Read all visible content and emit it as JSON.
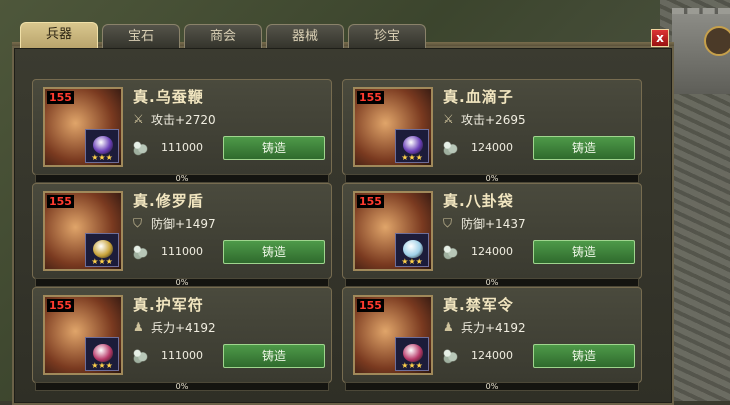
{
  "tabs": [
    {
      "label": "兵器",
      "active": true
    },
    {
      "label": "宝石"
    },
    {
      "label": "商会"
    },
    {
      "label": "器械"
    },
    {
      "label": "珍宝"
    }
  ],
  "close_label": "x",
  "forge_label": "铸造",
  "items": [
    {
      "level": "155",
      "name": "真.乌蚕鞭",
      "stat_icon": "sword-icon",
      "stat": "攻击+2720",
      "cost": "111000",
      "progress": "0%",
      "progress_value": 0,
      "gem_color": "#6a3fb8",
      "stars": "★★★"
    },
    {
      "level": "155",
      "name": "真.血滴子",
      "stat_icon": "sword-icon",
      "stat": "攻击+2695",
      "cost": "124000",
      "progress": "0%",
      "progress_value": 0,
      "gem_color": "#6a3fb8",
      "stars": "★★★"
    },
    {
      "level": "155",
      "name": "真.修罗盾",
      "stat_icon": "shield-icon",
      "stat": "防御+1497",
      "cost": "111000",
      "progress": "0%",
      "progress_value": 0,
      "gem_color": "#c8a33a",
      "stars": "★★★"
    },
    {
      "level": "155",
      "name": "真.八卦袋",
      "stat_icon": "shield-icon",
      "stat": "防御+1437",
      "cost": "124000",
      "progress": "0%",
      "progress_value": 0,
      "gem_color": "#9fd0e8",
      "stars": "★★★"
    },
    {
      "level": "155",
      "name": "真.护军符",
      "stat_icon": "soldier-icon",
      "stat": "兵力+4192",
      "cost": "111000",
      "progress": "0%",
      "progress_value": 0,
      "gem_color": "#b83a6a",
      "stars": "★★★"
    },
    {
      "level": "155",
      "name": "真.禁军令",
      "stat_icon": "soldier-icon",
      "stat": "兵力+4192",
      "cost": "124000",
      "progress": "0%",
      "progress_value": 0,
      "gem_color": "#b83a6a",
      "stars": "★★★"
    }
  ]
}
